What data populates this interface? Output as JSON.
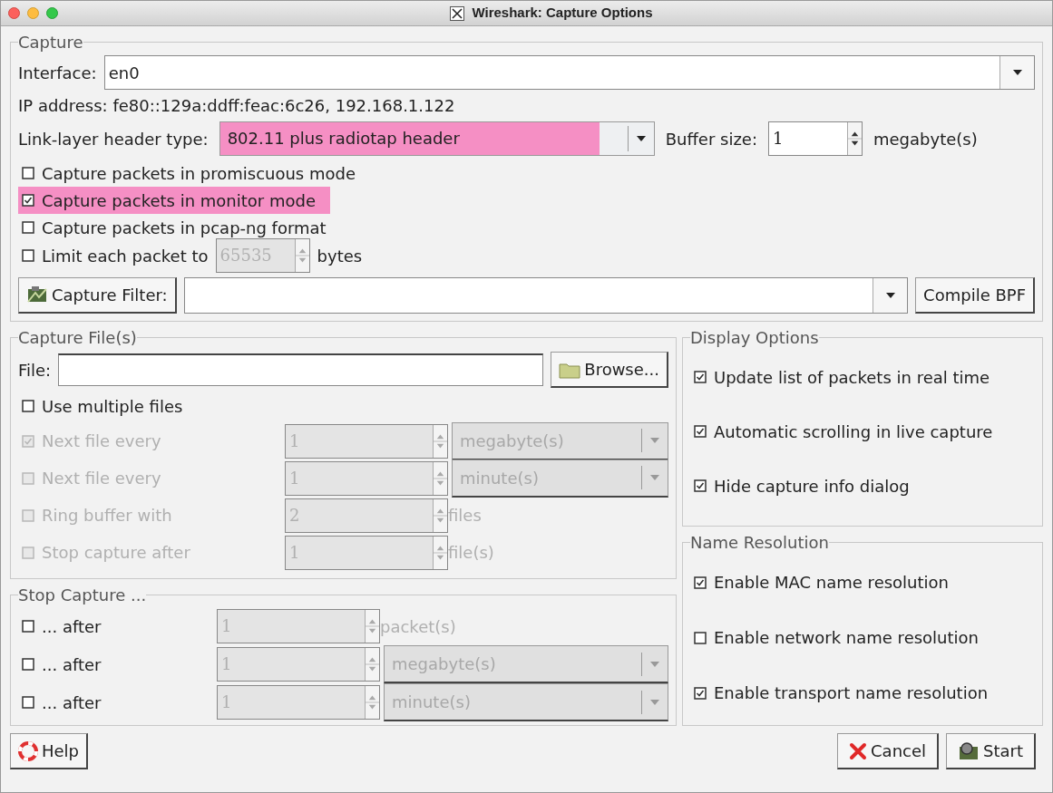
{
  "window": {
    "title": "Wireshark: Capture Options"
  },
  "capture": {
    "title": "Capture",
    "interface": {
      "label": "Interface:",
      "value": "en0"
    },
    "ip_address": "IP address: fe80::129a:ddff:feac:6c26, 192.168.1.122",
    "link_layer": {
      "label": "Link-layer header type:",
      "value": "802.11 plus radiotap header",
      "highlighted": true
    },
    "buffer": {
      "label": "Buffer size:",
      "value": "1",
      "unit": "megabyte(s)"
    },
    "options": [
      {
        "label": "Capture packets in promiscuous mode",
        "checked": false,
        "highlighted": false
      },
      {
        "label": "Capture packets in monitor mode",
        "checked": true,
        "highlighted": true
      },
      {
        "label": "Capture packets in pcap-ng format",
        "checked": false,
        "highlighted": false
      }
    ],
    "limit": {
      "label": "Limit each packet to",
      "checked": false,
      "value": "65535",
      "disabled": true,
      "unit": "bytes"
    },
    "filter": {
      "button": "Capture Filter:",
      "compile": "Compile BPF"
    }
  },
  "capture_files": {
    "title": "Capture File(s)",
    "file_label": "File:",
    "browse": "Browse...",
    "multiple": {
      "label": "Use multiple files",
      "checked": false
    },
    "rows": [
      {
        "kind": "combo",
        "label": "Next file every",
        "checked": true,
        "disabled": true,
        "input_disabled": true,
        "value": "1",
        "unit": "megabyte(s)"
      },
      {
        "kind": "combo",
        "label": "Next file every",
        "checked": false,
        "disabled": true,
        "input_disabled": true,
        "value": "1",
        "unit": "minute(s)"
      },
      {
        "kind": "spin",
        "label": "Ring buffer with",
        "checked": false,
        "disabled": true,
        "input_disabled": true,
        "value": "2",
        "unit": "files"
      },
      {
        "kind": "spin",
        "label": "Stop capture after",
        "checked": false,
        "disabled": true,
        "input_disabled": true,
        "value": "1",
        "unit": "file(s)"
      }
    ]
  },
  "stop_capture": {
    "title": "Stop Capture ...",
    "rows": [
      {
        "kind": "spin",
        "label": "... after",
        "checked": false,
        "disabled": false,
        "input_disabled": true,
        "value": "1",
        "unit": "packet(s)"
      },
      {
        "kind": "combo",
        "label": "... after",
        "checked": false,
        "disabled": false,
        "input_disabled": true,
        "value": "1",
        "unit": "megabyte(s)"
      },
      {
        "kind": "combo",
        "label": "... after",
        "checked": false,
        "disabled": false,
        "input_disabled": true,
        "value": "1",
        "unit": "minute(s)"
      }
    ]
  },
  "display_options": {
    "title": "Display Options",
    "items": [
      {
        "label": "Update list of packets in real time",
        "checked": true
      },
      {
        "label": "Automatic scrolling in live capture",
        "checked": true
      },
      {
        "label": "Hide capture info dialog",
        "checked": true
      }
    ]
  },
  "name_resolution": {
    "title": "Name Resolution",
    "items": [
      {
        "label": "Enable MAC name resolution",
        "checked": true
      },
      {
        "label": "Enable network name resolution",
        "checked": false
      },
      {
        "label": "Enable transport name resolution",
        "checked": true
      }
    ]
  },
  "buttons": {
    "help": {
      "label": "Help"
    },
    "cancel": {
      "label": "Cancel"
    },
    "start": {
      "label": "Start"
    }
  }
}
